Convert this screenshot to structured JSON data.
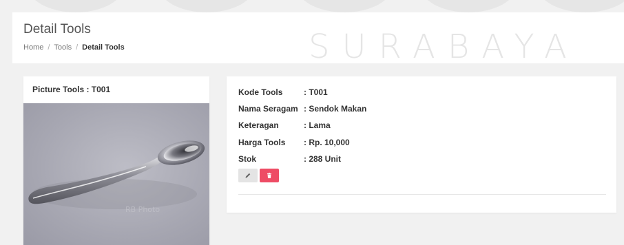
{
  "header": {
    "title": "Detail Tools",
    "breadcrumb": [
      "Home",
      "Tools",
      "Detail Tools"
    ]
  },
  "watermark": {
    "text": "SURABAYA"
  },
  "picture_card": {
    "title": "Picture Tools : T001",
    "image_caption": "RB Photo"
  },
  "details": [
    {
      "label": "Kode Tools",
      "value": ": T001"
    },
    {
      "label": "Nama Seragam",
      "value": ": Sendok Makan"
    },
    {
      "label": "Keteragan",
      "value": ": Lama"
    },
    {
      "label": "Harga Tools",
      "value": ": Rp. 10,000"
    },
    {
      "label": "Stok",
      "value": ": 288 Unit"
    }
  ],
  "actions": {
    "edit_icon": "pencil-icon",
    "delete_icon": "trash-icon"
  },
  "colors": {
    "delete": "#ee4c65",
    "edit": "#e4e4e4",
    "background": "#f1f1f1"
  }
}
